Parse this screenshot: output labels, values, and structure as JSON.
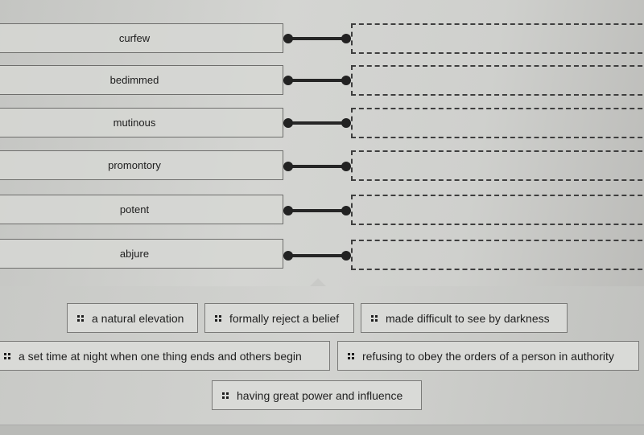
{
  "terms": [
    {
      "label": "curfew"
    },
    {
      "label": "bedimmed"
    },
    {
      "label": "mutinous"
    },
    {
      "label": "promontory"
    },
    {
      "label": "potent"
    },
    {
      "label": "abjure"
    }
  ],
  "drop_zones": [
    {
      "value": ""
    },
    {
      "value": ""
    },
    {
      "value": ""
    },
    {
      "value": ""
    },
    {
      "value": ""
    },
    {
      "value": ""
    }
  ],
  "definitions": [
    {
      "label": "a natural elevation",
      "icon": "drag-handle-icon"
    },
    {
      "label": "formally reject a belief",
      "icon": "drag-handle-icon"
    },
    {
      "label": "made difficult to see by darkness",
      "icon": "drag-handle-icon"
    },
    {
      "label": "a set time at night when one thing ends and others begin",
      "icon": "drag-handle-icon"
    },
    {
      "label": "refusing to obey the orders of a person in authority",
      "icon": "drag-handle-icon"
    },
    {
      "label": "having great power and influence",
      "icon": "drag-handle-icon"
    }
  ]
}
